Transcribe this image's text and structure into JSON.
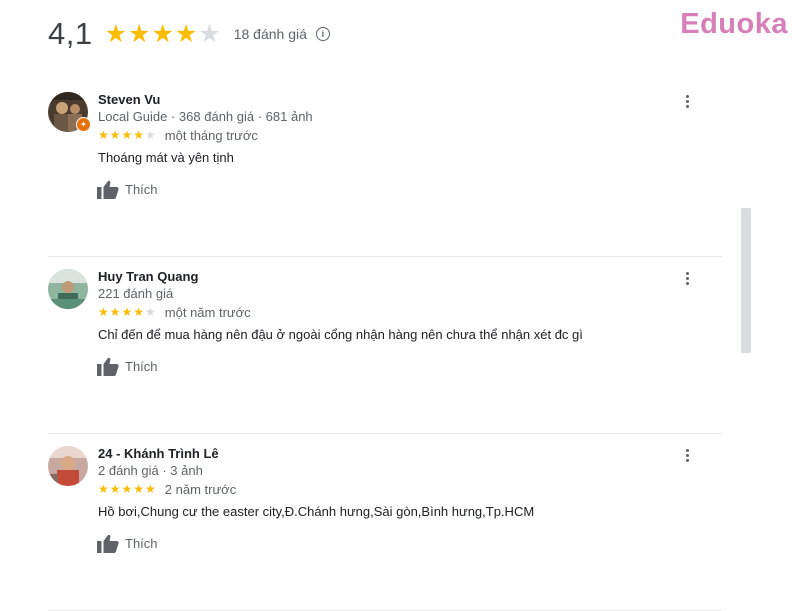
{
  "summary": {
    "rating": "4,1",
    "stars_filled": 4,
    "stars_total": 5,
    "review_count": "18 đánh giá",
    "info_icon": "info-icon"
  },
  "brand": {
    "logo_text": "Eduoka"
  },
  "reviews": [
    {
      "author": "Steven Vu",
      "meta": "Local Guide · 368 đánh giá · 681 ảnh",
      "local_guide": true,
      "rating": 4,
      "time": "một tháng trước",
      "text": "Thoáng mát và yên tịnh",
      "like_label": "Thích"
    },
    {
      "author": "Huy Tran Quang",
      "meta": "221 đánh giá",
      "local_guide": false,
      "rating": 4,
      "time": "một năm trước",
      "text": "Chỉ đến để mua hàng nên đậu ở ngoài cổng nhận hàng nên chưa thể nhận xét đc gì",
      "like_label": "Thích"
    },
    {
      "author": "24 - Khánh Trình Lê",
      "meta": "2 đánh giá · 3 ảnh",
      "local_guide": false,
      "rating": 5,
      "time": "2 năm trước",
      "text": "Hồ bơi,Chung cư the easter city,Đ.Chánh hưng,Sài gòn,Bình hưng,Tp.HCM",
      "like_label": "Thích"
    }
  ],
  "colors": {
    "star_filled": "#fbbc04",
    "star_empty": "#dadce0",
    "logo": "#d77fb9",
    "local_guide_badge": "#e8710a"
  }
}
